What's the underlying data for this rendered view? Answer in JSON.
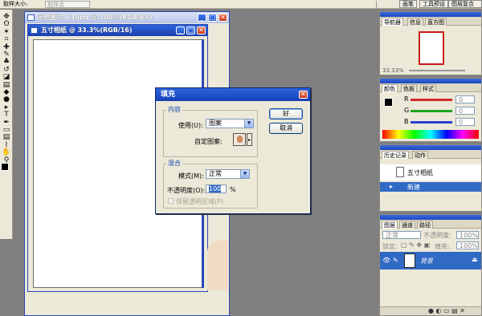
{
  "options_bar": {
    "label": "取样大小:",
    "sample_value": "取样点",
    "buttons": [
      "画笔",
      "工具预设",
      "图层复合"
    ]
  },
  "toolbox": {
    "icons": [
      "move-icon",
      "lasso-icon",
      "magic-wand-icon",
      "crop-icon",
      "healing-brush-icon",
      "brush-icon",
      "stamp-icon",
      "history-brush-icon",
      "eraser-icon",
      "gradient-icon",
      "blur-icon",
      "dodge-icon",
      "path-select-icon",
      "type-icon",
      "pen-icon",
      "shape-icon",
      "notes-icon",
      "eyedropper-icon",
      "hand-icon",
      "zoom-icon"
    ],
    "glyphs": [
      "✥",
      "ʘ",
      "✶",
      "⌗",
      "✚",
      "✎",
      "♣",
      "↺",
      "◪",
      "▤",
      "◆",
      "●",
      "▸",
      "T",
      "✒",
      "▭",
      "▤",
      "⌇",
      "✋",
      "⚲"
    ]
  },
  "background_doc": {
    "title": "示例图片 03.jpg @ 100%(RGB/8#)"
  },
  "active_doc": {
    "title": "五寸相纸 @ 33.3%(RGB/16)"
  },
  "fill_dialog": {
    "title": "填充",
    "contents_group": "内容",
    "use_label": "使用(U):",
    "use_value": "图案",
    "custom_pattern_label": "自定图案:",
    "blending_group": "混合",
    "mode_label": "模式(M):",
    "mode_value": "正常",
    "opacity_label": "不透明度(O):",
    "opacity_value": "100",
    "opacity_unit": "%",
    "preserve_label": "保留透明区域(P)",
    "ok_label": "好",
    "cancel_label": "取消"
  },
  "navigator_panel": {
    "tabs": [
      "导航器",
      "信息",
      "直方图"
    ],
    "zoom": "33.33%"
  },
  "color_panel": {
    "tabs": [
      "颜色",
      "色板",
      "样式"
    ],
    "channels": [
      {
        "label": "R",
        "value": "0",
        "color": "#d12a2a"
      },
      {
        "label": "G",
        "value": "0",
        "color": "#1fa31f"
      },
      {
        "label": "B",
        "value": "0",
        "color": "#2a3fd1"
      }
    ]
  },
  "history_panel": {
    "tabs": [
      "历史记录",
      "动作"
    ],
    "snapshot": "五寸相纸",
    "items": [
      "新建"
    ]
  },
  "layers_panel": {
    "tabs": [
      "图层",
      "通道",
      "路径"
    ],
    "blend_mode": "正常",
    "opacity_label": "不透明度:",
    "opacity_value": "100%",
    "lock_label": "锁定:",
    "fill_label": "填充:",
    "fill_value": "100%",
    "layer_name": "背景"
  }
}
